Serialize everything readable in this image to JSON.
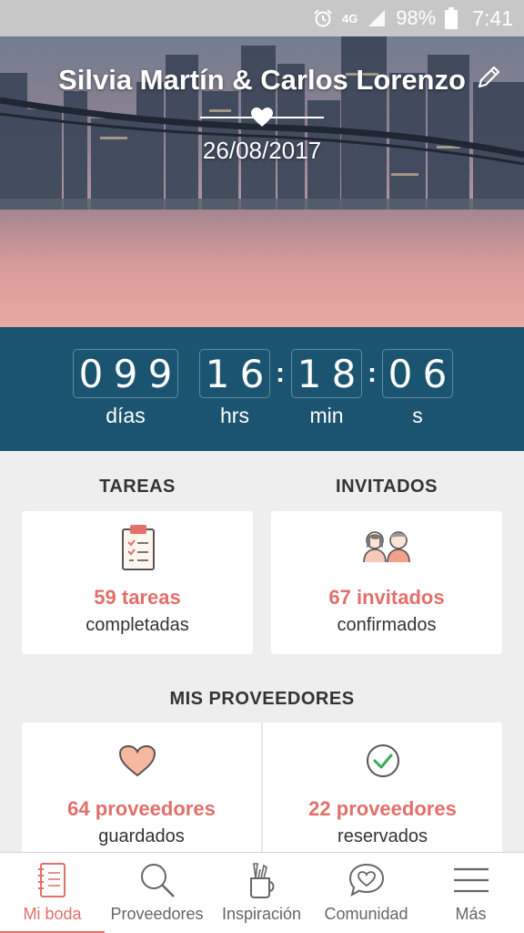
{
  "status_bar": {
    "network": "4G",
    "battery": "98%",
    "time": "7:41",
    "icons": [
      "alarm-icon",
      "signal-icon",
      "battery-icon"
    ]
  },
  "hero": {
    "couple_names": "Silvia Martín & Carlos Lorenzo",
    "wedding_date": "26/08/2017"
  },
  "countdown": {
    "days_digits": [
      "0",
      "9",
      "9"
    ],
    "hours_digits": [
      "1",
      "6"
    ],
    "minutes_digits": [
      "1",
      "8"
    ],
    "seconds_digits": [
      "0",
      "6"
    ],
    "days_label": "días",
    "hours_label": "hrs",
    "minutes_label": "min",
    "seconds_label": "s",
    "separator": ":"
  },
  "tasks": {
    "title": "TAREAS",
    "count": "59 tareas",
    "sub": "completadas"
  },
  "guests": {
    "title": "INVITADOS",
    "count": "67 invitados",
    "sub": "confirmados"
  },
  "providers": {
    "title": "MIS PROVEEDORES",
    "saved_count": "64 proveedores",
    "saved_sub": "guardados",
    "booked_count": "22 proveedores",
    "booked_sub": "reservados"
  },
  "bottom_nav": {
    "items": [
      {
        "label": "Mi boda",
        "icon": "notebook-icon",
        "active": true
      },
      {
        "label": "Proveedores",
        "icon": "search-icon",
        "active": false
      },
      {
        "label": "Inspiración",
        "icon": "pencil-cup-icon",
        "active": false
      },
      {
        "label": "Comunidad",
        "icon": "heart-bubble-icon",
        "active": false
      },
      {
        "label": "Más",
        "icon": "menu-icon",
        "active": false
      }
    ]
  },
  "colors": {
    "accent": "#e36f6b",
    "countdown_bg": "#1b5471",
    "page_bg": "#eeeeee"
  }
}
